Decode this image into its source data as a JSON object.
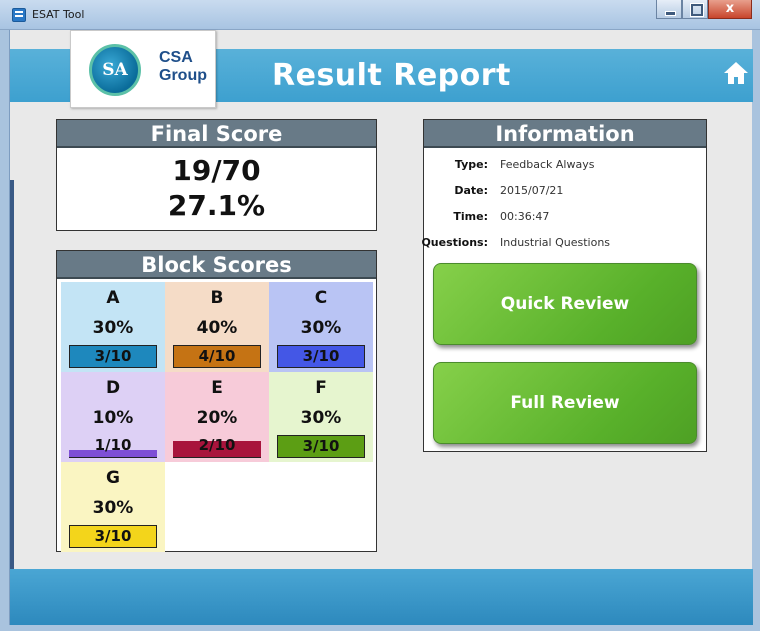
{
  "window": {
    "title": "ESAT Tool",
    "close_glyph": "x"
  },
  "header": {
    "logo_mark": "SA",
    "logo_line1": "CSA",
    "logo_line2": "Group",
    "title": "Result Report",
    "home_icon": "home-icon",
    "bar_color": "#4aa9d6"
  },
  "final_score": {
    "heading": "Final Score",
    "points": "19/70",
    "percent": "27.1%"
  },
  "block_scores": {
    "heading": "Block Scores",
    "blocks": [
      {
        "letter": "A",
        "percent": "30%",
        "fraction": "3/10",
        "level": 1.0,
        "bg": "#c3e4f5",
        "bar": "#1e88bd"
      },
      {
        "letter": "B",
        "percent": "40%",
        "fraction": "4/10",
        "level": 1.0,
        "bg": "#f5dcc7",
        "bar": "#c57314"
      },
      {
        "letter": "C",
        "percent": "30%",
        "fraction": "3/10",
        "level": 1.0,
        "bg": "#b9c4f4",
        "bar": "#4457e6"
      },
      {
        "letter": "D",
        "percent": "10%",
        "fraction": "1/10",
        "level": 0.3,
        "bg": "#ddd0f5",
        "bar": "#7e4fd6"
      },
      {
        "letter": "E",
        "percent": "20%",
        "fraction": "2/10",
        "level": 0.75,
        "bg": "#f7cbd9",
        "bar": "#a8143c"
      },
      {
        "letter": "F",
        "percent": "30%",
        "fraction": "3/10",
        "level": 1.0,
        "bg": "#e6f5cf",
        "bar": "#5c9e14"
      },
      {
        "letter": "G",
        "percent": "30%",
        "fraction": "3/10",
        "level": 1.0,
        "bg": "#faf5c2",
        "bar": "#f3d51b"
      }
    ]
  },
  "information": {
    "heading": "Information",
    "rows": [
      {
        "label": "Type:",
        "value": "Feedback Always"
      },
      {
        "label": "Date:",
        "value": "2015/07/21"
      },
      {
        "label": "Time:",
        "value": "00:36:47"
      },
      {
        "label": "Questions:",
        "value": "Industrial Questions"
      }
    ],
    "quick_review_label": "Quick Review",
    "full_review_label": "Full Review",
    "button_color": "#64b832"
  },
  "footer": {
    "bar_color": "#3a98c9"
  }
}
